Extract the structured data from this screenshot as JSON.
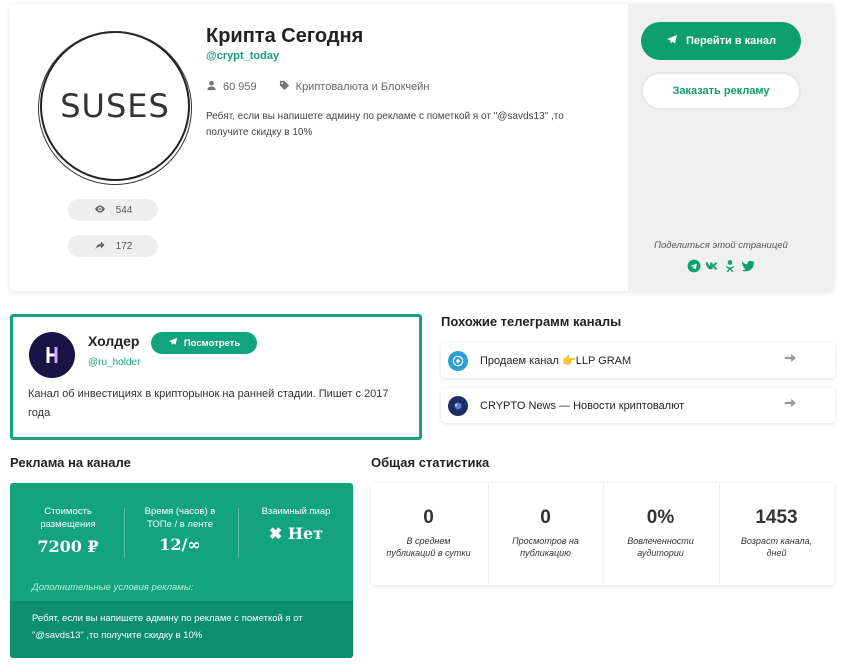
{
  "channel": {
    "logo_text": "SUSES",
    "title": "Крипта Сегодня",
    "handle": "@crypt_today",
    "subscribers": "60 959",
    "category": "Криптовалюта и Блокчейн",
    "description": "Ребят, если вы напишете админу по рекламе с пометкой я от \"@savds13\" ,то получите скидку в 10%",
    "views": "544",
    "shares": "172"
  },
  "actions": {
    "go_label": "Перейти в канал",
    "order_label": "Заказать рекламу",
    "share_label": "Поделиться этой страницей"
  },
  "share_icons": [
    "telegram-icon",
    "vk-icon",
    "odnoklassniki-icon",
    "twitter-icon"
  ],
  "holder": {
    "name": "Холдер",
    "view_label": "Посмотреть",
    "handle": "@ru_holder",
    "description": "Канал об инвестициях в крипторынок на ранней стадии. Пишет с 2017 года"
  },
  "similar": {
    "title": "Похожие телеграмм каналы",
    "items": [
      {
        "label": "Продаем канал 👉LLP GRAM"
      },
      {
        "label": "CRYPTO News — Новости криптовалют"
      }
    ]
  },
  "ad": {
    "title": "Реклама на канале",
    "price_label": "Стоимость размещения",
    "price_value": "7200 ₽",
    "time_label": "Время (часов) в ТОПе / в ленте",
    "time_value": "12/∞",
    "mutual_label": "Взаимный пиар",
    "mutual_value": "✖ Нет",
    "extra_label": "Дополнительные условия рекламы:",
    "extra_text": "Ребят, если вы напишете админу по рекламе с пометкой я от \"@savds13\" ,то получите скидку в 10%"
  },
  "stats": {
    "title": "Общая статистика",
    "items": [
      {
        "value": "0",
        "caption": "В среднем публикаций в сутки"
      },
      {
        "value": "0",
        "caption": "Просмотров на публикацию"
      },
      {
        "value": "0%",
        "caption": "Вовлеченности аудитории"
      },
      {
        "value": "1453",
        "caption": "Возраст канала, дней"
      }
    ]
  },
  "colors": {
    "accent": "#14a37f",
    "accent_dark": "#0e8f6c",
    "panel": "#f0f0f0"
  }
}
